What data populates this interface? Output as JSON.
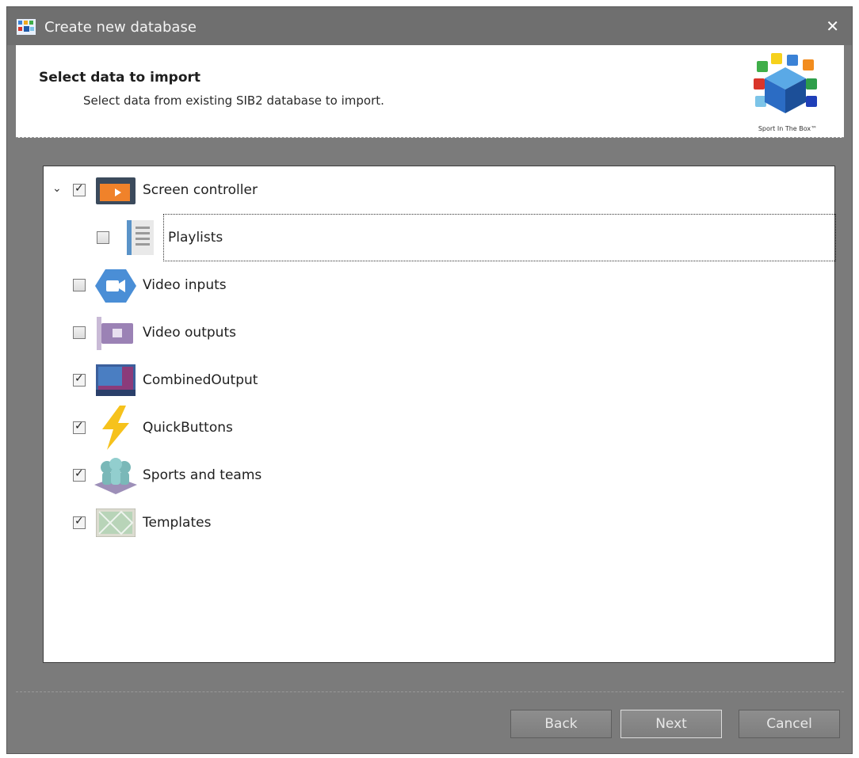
{
  "window": {
    "title": "Create new database"
  },
  "header": {
    "heading": "Select data to import",
    "subheading": "Select data from existing SIB2 database to import.",
    "logo_caption": "Sport In The Box™"
  },
  "tree": {
    "items": [
      {
        "label": "Screen controller",
        "checked": true,
        "icon": "screen-controller-icon"
      },
      {
        "label": "Playlists",
        "checked": false,
        "icon": "playlist-icon"
      },
      {
        "label": "Video inputs",
        "checked": false,
        "icon": "video-input-icon"
      },
      {
        "label": "Video outputs",
        "checked": false,
        "icon": "video-output-icon"
      },
      {
        "label": "CombinedOutput",
        "checked": true,
        "icon": "combined-output-icon"
      },
      {
        "label": "QuickButtons",
        "checked": true,
        "icon": "lightning-icon"
      },
      {
        "label": "Sports and teams",
        "checked": true,
        "icon": "sports-teams-icon"
      },
      {
        "label": "Templates",
        "checked": true,
        "icon": "templates-icon"
      }
    ]
  },
  "buttons": {
    "back": "Back",
    "next": "Next",
    "cancel": "Cancel"
  }
}
